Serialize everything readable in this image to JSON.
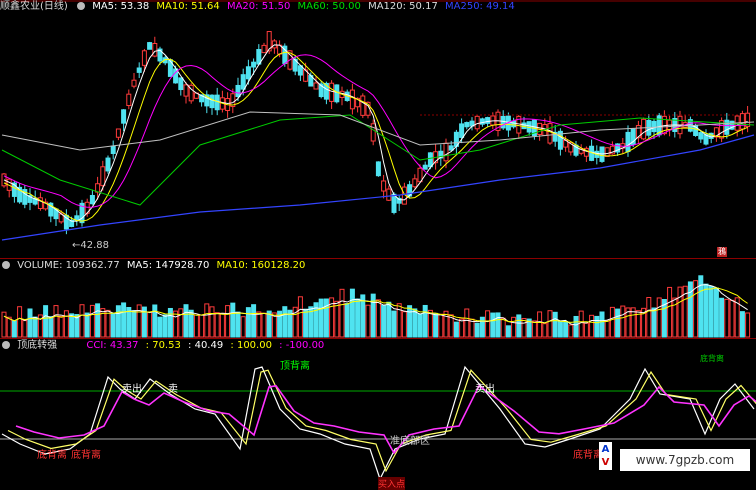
{
  "price_header": {
    "title": "顺鑫农业(日线)",
    "ma5": "MA5: 53.38",
    "ma10": "MA10: 51.64",
    "ma20": "MA20: 51.50",
    "ma60": "MA60: 50.00",
    "ma120": "MA120: 50.17",
    "ma250": "MA250: 49.14"
  },
  "price_low_label": "42.88",
  "price_marker": "鴉",
  "volume_header": {
    "volume": "VOLUME: 109362.77",
    "ma5": "MA5: 147928.70",
    "ma10": "MA10: 160128.20"
  },
  "indicator_header": {
    "name": "顶底转强",
    "cci": "CCI: 43.37",
    "v2": ": 70.53",
    "v3": ": 40.49",
    "v4": ": 100.00",
    "v5": ": -100.00"
  },
  "indicator_labels": {
    "top_divergence": "顶背离",
    "bottom_divergence_1": "底背离",
    "bottom_divergence_2": "底背离",
    "bottom_divergence_3": "底背离",
    "sell_1": "卖",
    "sell_2": "卖出",
    "sell_3": "卖出",
    "bottom_area": "准底部区",
    "buy_point": "买入点",
    "right_label": "底背离"
  },
  "watermark": "www.7gpzb.com",
  "colors": {
    "up": "#ff3b3b",
    "down": "#4fe3f0",
    "ma5": "#ffffff",
    "ma10": "#ffff00",
    "ma20": "#ff00ff",
    "ma60": "#00cc00",
    "ma120": "#c0c0c0",
    "ma250": "#3344ff",
    "cci": "#ffffff",
    "fast": "#ffff66",
    "slow": "#ff33ff"
  }
}
